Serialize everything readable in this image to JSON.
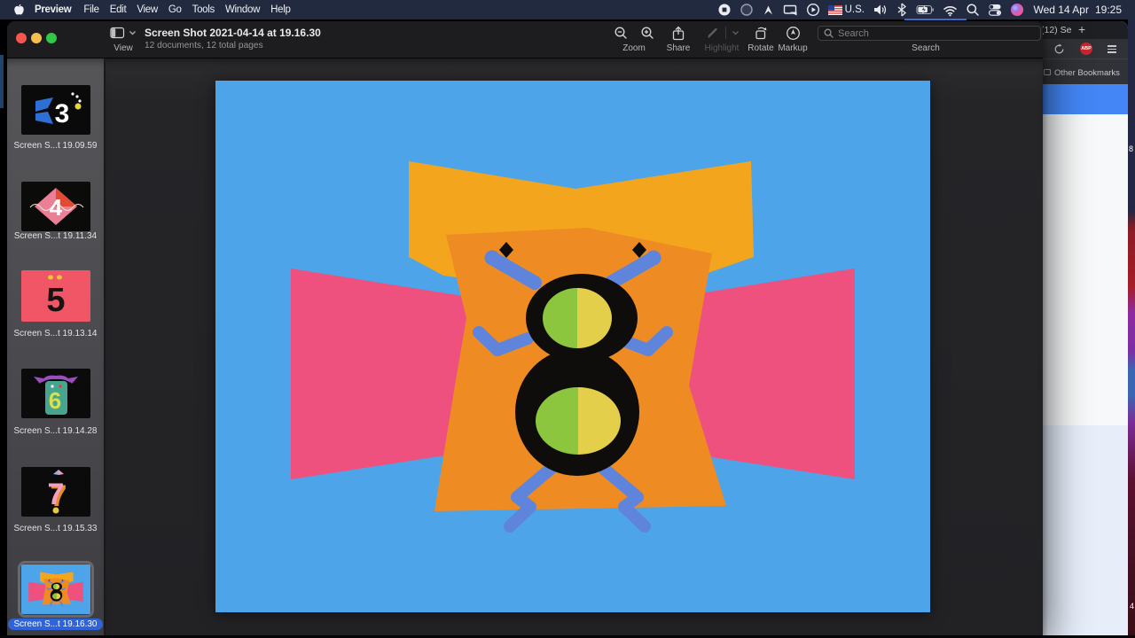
{
  "menu_bar": {
    "menus": [
      "Preview",
      "File",
      "Edit",
      "View",
      "Go",
      "Tools",
      "Window",
      "Help"
    ],
    "status": {
      "input_source": "U.S.",
      "clock_date": "Wed 14 Apr",
      "clock_time": "19:25"
    }
  },
  "window": {
    "title": "Screen Shot 2021-04-14 at 19.16.30",
    "subtitle": "12 documents, 12 total pages",
    "toolbar": {
      "view": "View",
      "zoom": "Zoom",
      "share": "Share",
      "highlight": "Highlight",
      "rotate": "Rotate",
      "markup": "Markup",
      "search_label": "Search",
      "search_placeholder": "Search"
    }
  },
  "sidebar": {
    "items": [
      {
        "label": "Screen S...t 19.09.59",
        "digit": "3",
        "selected": false
      },
      {
        "label": "Screen S...t 19.11.34",
        "digit": "4",
        "selected": false
      },
      {
        "label": "Screen S...t 19.13.14",
        "digit": "5",
        "selected": false
      },
      {
        "label": "Screen S...t 19.14.28",
        "digit": "6",
        "selected": false
      },
      {
        "label": "Screen S...t 19.15.33",
        "digit": "7",
        "selected": false
      },
      {
        "label": "Screen S...t 19.16.30",
        "digit": "8",
        "selected": true
      }
    ]
  },
  "browser": {
    "tab_title": "(12) Se",
    "new_tab_label": "+",
    "adblock_badge": "ABP",
    "bookmarks_label": "Other Bookmarks"
  },
  "desktop": {
    "icon_labels": [
      "8",
      "4"
    ]
  },
  "artwork": {
    "colors": {
      "background": "#4da4e9",
      "bowtie": "#f3a51e",
      "body": "#ee8c23",
      "wings": "#ef517e",
      "outline": "#0e0d0b",
      "fill_left": "#8cc63f",
      "fill_right": "#e4cf4b",
      "limbs": "#5f84db"
    }
  }
}
